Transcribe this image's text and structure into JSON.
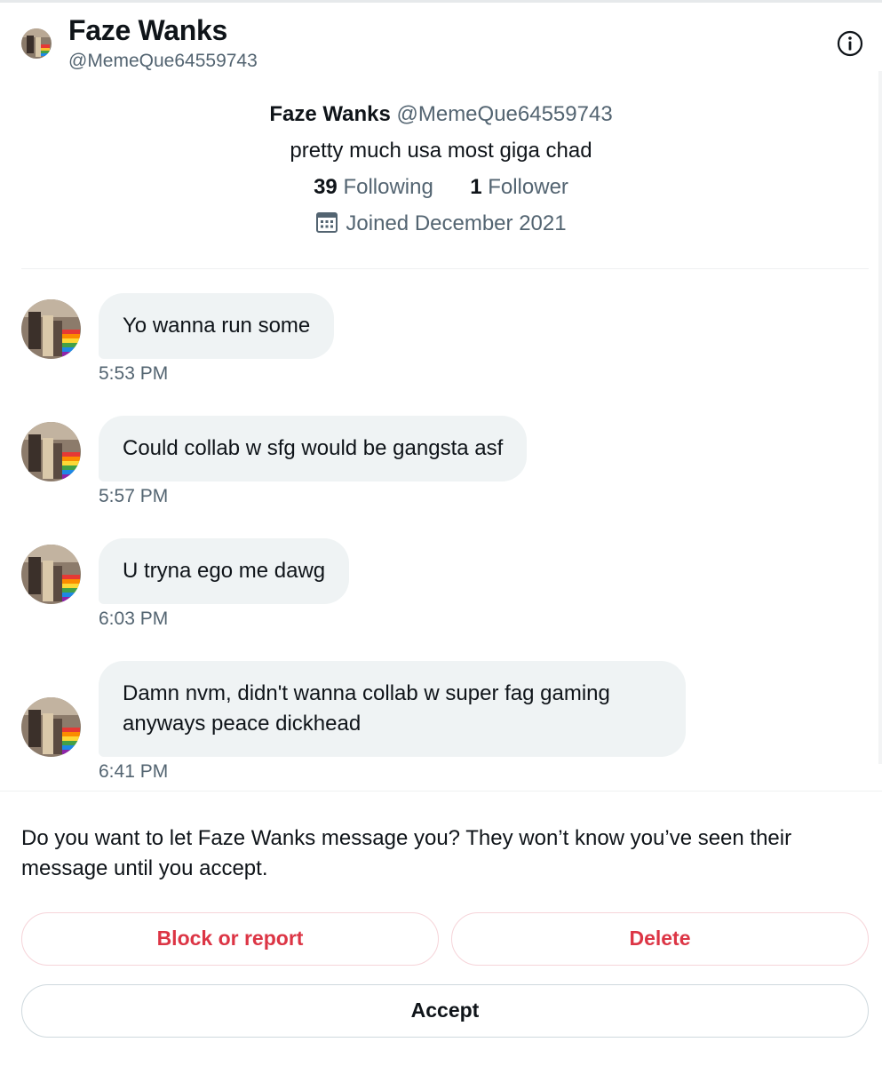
{
  "header": {
    "name": "Faze Wanks",
    "handle": "@MemeQue64559743"
  },
  "profile": {
    "name": "Faze Wanks",
    "handle": "@MemeQue64559743",
    "bio": "pretty much usa most giga chad",
    "following_count": "39",
    "following_label": "Following",
    "follower_count": "1",
    "follower_label": "Follower",
    "joined": "Joined December 2021"
  },
  "messages": [
    {
      "text": "Yo wanna run some",
      "time": "5:53 PM"
    },
    {
      "text": "Could collab w sfg would be gangsta asf",
      "time": "5:57 PM"
    },
    {
      "text": "U tryna ego me dawg",
      "time": "6:03 PM"
    },
    {
      "text": "Damn nvm, didn't wanna collab w super fag gaming anyways peace dickhead",
      "time": "6:41 PM"
    }
  ],
  "request": {
    "prompt": "Do you want to let Faze Wanks message you? They won’t know you’ve seen their message until you accept.",
    "block_label": "Block or report",
    "delete_label": "Delete",
    "accept_label": "Accept"
  },
  "icons": {
    "info": "info-circle-icon",
    "calendar": "calendar-icon"
  },
  "colors": {
    "text_primary": "#0f1419",
    "text_secondary": "#536471",
    "bubble_bg": "#eff3f4",
    "danger": "#dc3545"
  }
}
